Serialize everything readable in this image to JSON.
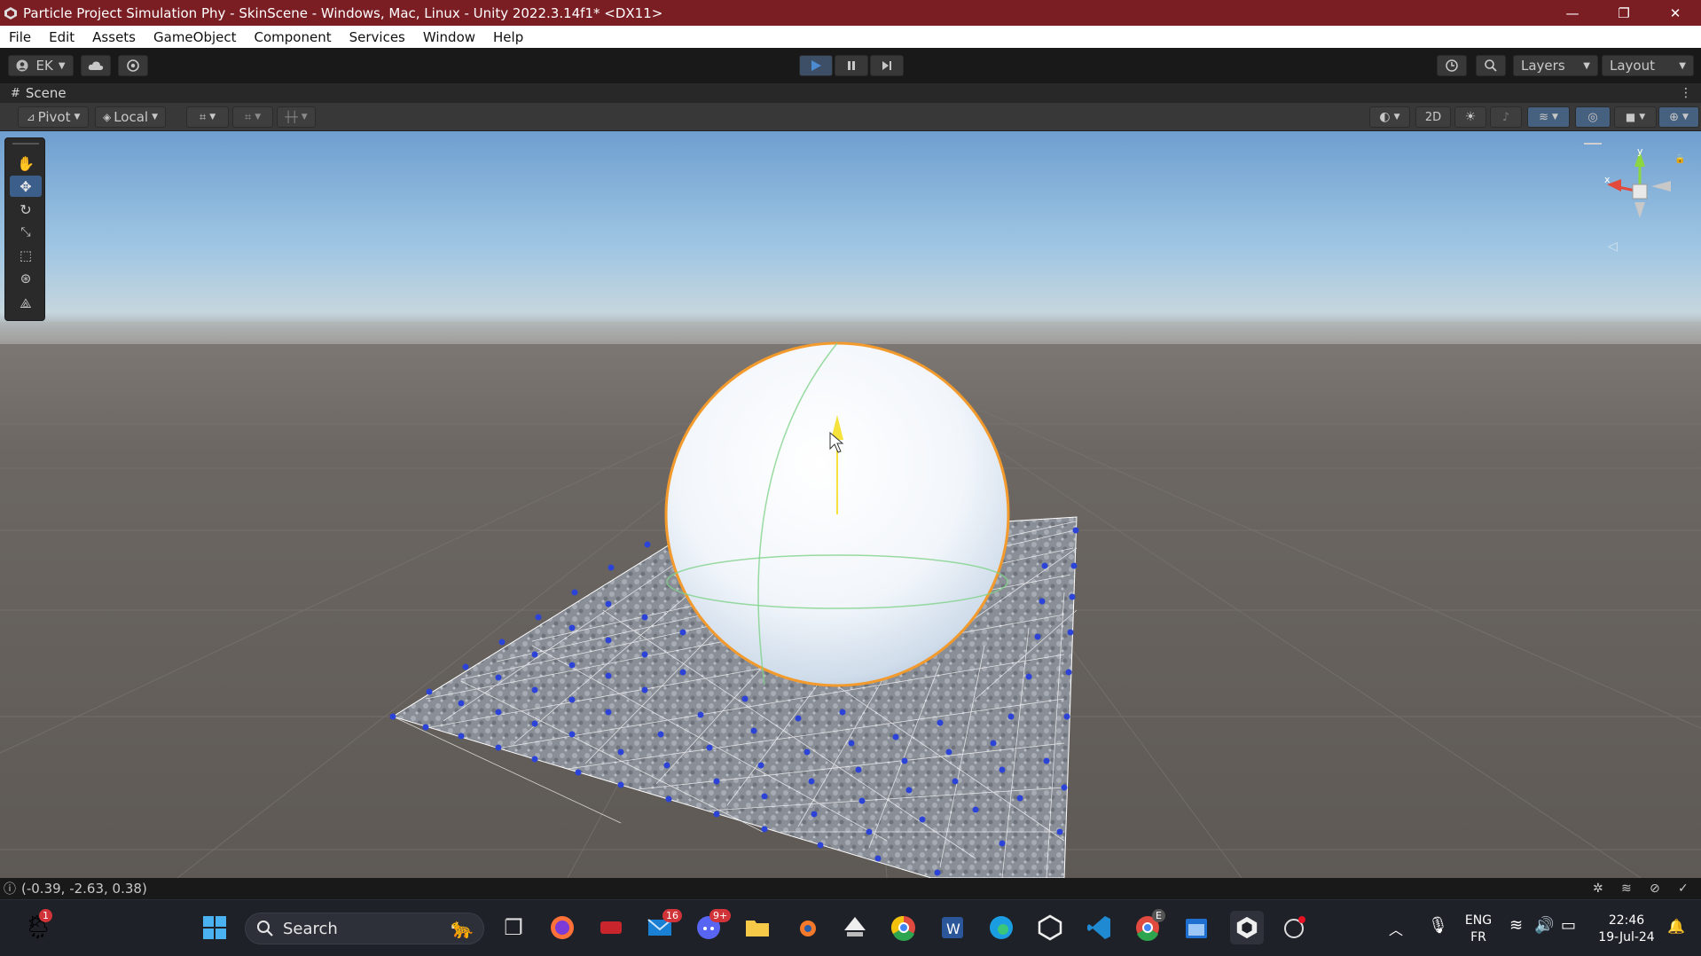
{
  "window": {
    "title": "Particle Project Simulation Phy - SkinScene - Windows, Mac, Linux - Unity 2022.3.14f1* <DX11>",
    "minimize_glyph": "—",
    "restore_glyph": "❐",
    "close_glyph": "✕"
  },
  "menu": {
    "items": [
      "File",
      "Edit",
      "Assets",
      "GameObject",
      "Component",
      "Services",
      "Window",
      "Help"
    ]
  },
  "toolbar": {
    "account_label": "EK",
    "layers_label": "Layers",
    "layout_label": "Layout"
  },
  "scene_tab": {
    "label": "Scene"
  },
  "scene_toolbar": {
    "pivot_label": "Pivot",
    "local_label": "Local",
    "mode_2d_label": "2D"
  },
  "gizmo": {
    "x_label": "x",
    "y_label": "y"
  },
  "status": {
    "coordinates": "(-0.39, -2.63, 0.38)"
  },
  "taskbar": {
    "search_placeholder": "Search",
    "mail_badge": "16",
    "discord_badge": "9+",
    "weather_badge": "1",
    "chrome_badge": "E",
    "language_line1": "ENG",
    "language_line2": "FR",
    "time": "22:46",
    "date": "19-Jul-24"
  },
  "colors": {
    "titlebar": "#7a1e24",
    "accent_play": "#4c8ad1",
    "tool_active": "#3b5e8a"
  }
}
